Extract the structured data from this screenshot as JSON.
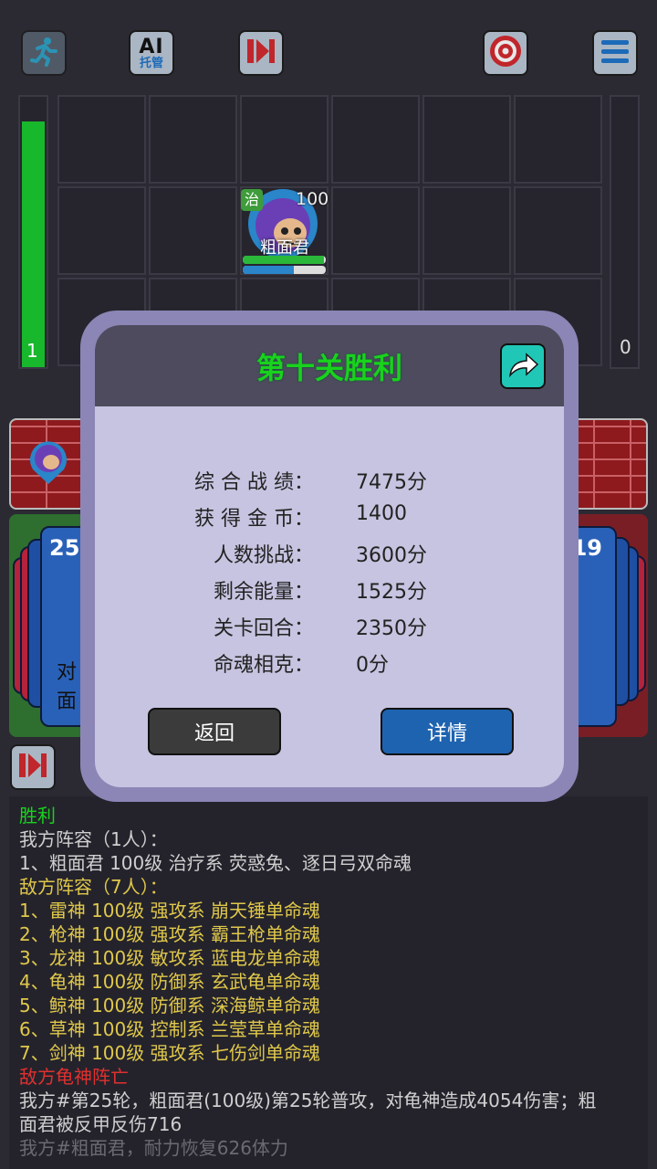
{
  "toolbar": {
    "flee_icon": "running-man-icon",
    "ai_line1": "AI",
    "ai_line2": "托管",
    "skip_icon": "skip-forward-icon",
    "target_icon": "target-icon",
    "menu_icon": "menu-icon"
  },
  "battlefield": {
    "left_energy": "1",
    "left_energy_level": 0.91,
    "right_energy": "0",
    "hero": {
      "name": "粗面君",
      "level": "100",
      "class_badge": "治",
      "hp_fraction": 0.98,
      "mp_fraction": 0.62
    }
  },
  "decks": {
    "left_count": "25",
    "right_count": "19",
    "left_card_text_1": "对",
    "left_card_text_2": "面"
  },
  "modal": {
    "title": "第十关胜利",
    "share_icon": "share-arrow-icon",
    "stats": [
      {
        "label": "综 合 战 绩：",
        "value": "7475分"
      },
      {
        "label": "获 得 金 币：",
        "value": "1400"
      },
      {
        "label": "人数挑战：",
        "value": "3600分"
      },
      {
        "label": "剩余能量：",
        "value": "1525分"
      },
      {
        "label": "关卡回合：",
        "value": "2350分"
      },
      {
        "label": "命魂相克：",
        "value": "0分"
      }
    ],
    "back_label": "返回",
    "detail_label": "详情"
  },
  "colors": {
    "title_green": "#19d21c",
    "log_yellow": "#e0c84a",
    "log_red": "#e0312f",
    "detail_blue": "#1e63b0"
  },
  "log": {
    "lines": [
      {
        "text": "胜利",
        "color": "green"
      },
      {
        "text": "我方阵容（1人）：",
        "color": "grey"
      },
      {
        "text": "1、粗面君 100级 治疗系 荧惑兔、逐日弓双命魂",
        "color": "grey"
      },
      {
        "text": "敌方阵容（7人）：",
        "color": "yellow"
      },
      {
        "text": "1、雷神 100级 强攻系 崩天锤单命魂",
        "color": "yellow"
      },
      {
        "text": "2、枪神 100级 强攻系 霸王枪单命魂",
        "color": "yellow"
      },
      {
        "text": "3、龙神 100级 敏攻系 蓝电龙单命魂",
        "color": "yellow"
      },
      {
        "text": "4、龟神 100级 防御系 玄武龟单命魂",
        "color": "yellow"
      },
      {
        "text": "5、鲸神 100级 防御系 深海鲸单命魂",
        "color": "yellow"
      },
      {
        "text": "6、草神 100级 控制系 兰莹草单命魂",
        "color": "yellow"
      },
      {
        "text": "7、剑神 100级 强攻系 七伤剑单命魂",
        "color": "yellow"
      },
      {
        "text": "敌方龟神阵亡",
        "color": "red"
      },
      {
        "text": "我方#第25轮，粗面君(100级)第25轮普攻，对龟神造成4054伤害；粗",
        "color": "grey"
      },
      {
        "text": "面君被反甲反伤716",
        "color": "grey"
      },
      {
        "text": "我方#粗面君，耐力恢复626体力",
        "color": "dim"
      }
    ]
  }
}
